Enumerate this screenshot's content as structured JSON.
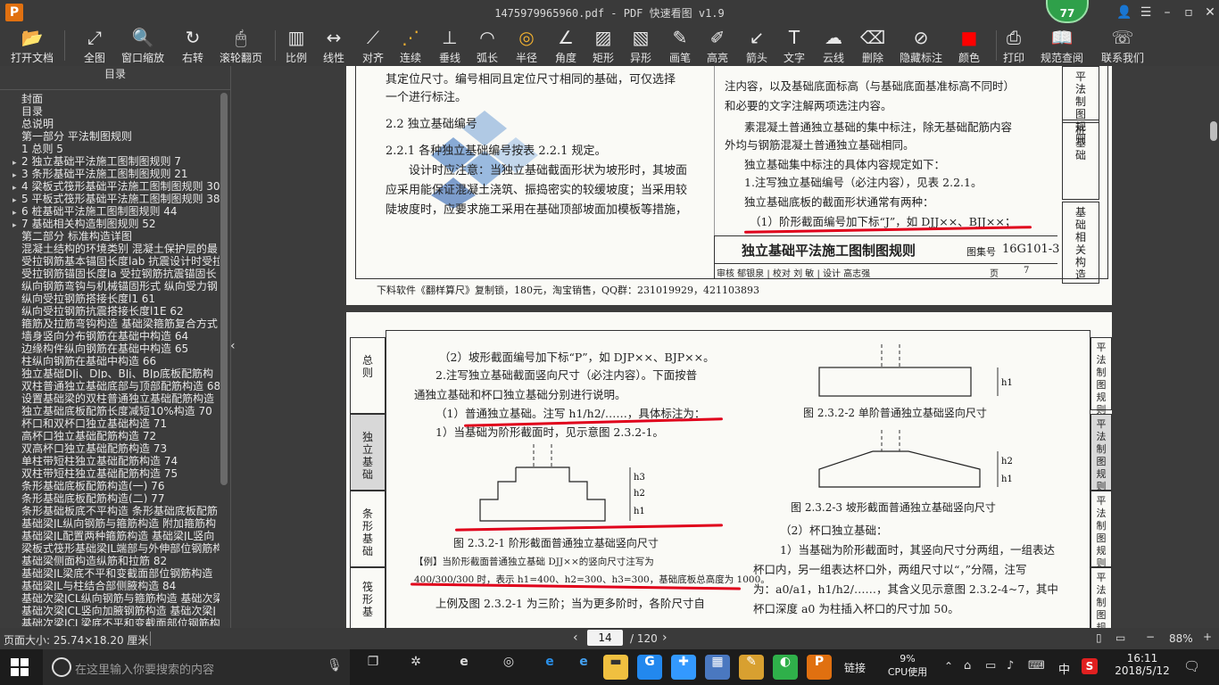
{
  "window": {
    "title": "1475979965960.pdf - PDF 快速看图 v1.9",
    "badge": "77"
  },
  "toolbar": [
    {
      "name": "open",
      "label": "打开文档",
      "icon": "📂"
    },
    {
      "name": "fit-all",
      "label": "全图",
      "icon": "⤢"
    },
    {
      "name": "window-zoom",
      "label": "窗口缩放",
      "icon": "🔍"
    },
    {
      "name": "rotate",
      "label": "右转",
      "icon": "↻"
    },
    {
      "name": "scroll-page",
      "label": "滚轮翻页",
      "icon": "🖱"
    },
    {
      "name": "scale",
      "label": "比例",
      "icon": "▥"
    },
    {
      "name": "linear",
      "label": "线性",
      "icon": "↔"
    },
    {
      "name": "align",
      "label": "对齐",
      "icon": "⟋"
    },
    {
      "name": "continuous",
      "label": "连续",
      "icon": "⋰"
    },
    {
      "name": "perpendicular",
      "label": "垂线",
      "icon": "⊥"
    },
    {
      "name": "arc",
      "label": "弧长",
      "icon": "◠"
    },
    {
      "name": "radius",
      "label": "半径",
      "icon": "◎"
    },
    {
      "name": "angle",
      "label": "角度",
      "icon": "∠"
    },
    {
      "name": "rect",
      "label": "矩形",
      "icon": "▨"
    },
    {
      "name": "shape",
      "label": "异形",
      "icon": "▧"
    },
    {
      "name": "pen",
      "label": "画笔",
      "icon": "✎"
    },
    {
      "name": "highlight",
      "label": "高亮",
      "icon": "✐"
    },
    {
      "name": "arrow",
      "label": "箭头",
      "icon": "↙"
    },
    {
      "name": "text",
      "label": "文字",
      "icon": "T"
    },
    {
      "name": "cloud",
      "label": "云线",
      "icon": "☁"
    },
    {
      "name": "delete",
      "label": "删除",
      "icon": "⌫"
    },
    {
      "name": "hide",
      "label": "隐藏标注",
      "icon": "⊘"
    },
    {
      "name": "color",
      "label": "颜色",
      "icon": "■"
    },
    {
      "name": "print",
      "label": "打印",
      "icon": "⎙"
    },
    {
      "name": "spec",
      "label": "规范查阅",
      "icon": "📖"
    },
    {
      "name": "contact",
      "label": "联系我们",
      "icon": "☏"
    }
  ],
  "sidebar": {
    "title": "目录",
    "items": [
      {
        "text": "封面",
        "arrow": ""
      },
      {
        "text": "目录",
        "arrow": ""
      },
      {
        "text": "总说明",
        "arrow": ""
      },
      {
        "text": "第一部分  平法制图规则",
        "arrow": ""
      },
      {
        "text": "1 总则 5",
        "arrow": ""
      },
      {
        "text": "2 独立基础平法施工图制图规则 7",
        "arrow": "▸"
      },
      {
        "text": "3 条形基础平法施工图制图规则 21",
        "arrow": "▸"
      },
      {
        "text": "4 梁板式筏形基础平法施工图制图规则 30",
        "arrow": "▸"
      },
      {
        "text": "5 平板式筏形基础平法施工图制图规则 38",
        "arrow": "▸"
      },
      {
        "text": "6 桩基础平法施工图制图规则 44",
        "arrow": "▸"
      },
      {
        "text": "7 基础相关构造制图规则 52",
        "arrow": "▸"
      },
      {
        "text": "第二部分  标准构造详图",
        "arrow": ""
      },
      {
        "text": "混凝土结构的环境类别 混凝土保护层的最",
        "arrow": ""
      },
      {
        "text": "受拉钢筋基本锚固长度lab 抗震设计时受拉",
        "arrow": ""
      },
      {
        "text": "受拉钢筋锚固长度la 受拉钢筋抗震锚固长",
        "arrow": ""
      },
      {
        "text": "纵向钢筋弯钩与机械锚固形式 纵向受力钢",
        "arrow": ""
      },
      {
        "text": "纵向受拉钢筋搭接长度l1 61",
        "arrow": ""
      },
      {
        "text": "纵向受拉钢筋抗震搭接长度l1E 62",
        "arrow": ""
      },
      {
        "text": "箍筋及拉筋弯钩构造 基础梁箍筋复合方式",
        "arrow": ""
      },
      {
        "text": "墙身竖向分布钢筋在基础中构造 64",
        "arrow": ""
      },
      {
        "text": "边缘构件纵向钢筋在基础中构造 65",
        "arrow": ""
      },
      {
        "text": "柱纵向钢筋在基础中构造 66",
        "arrow": ""
      },
      {
        "text": "独立基础DJj、DJp、BJj、BJp底板配筋构",
        "arrow": ""
      },
      {
        "text": "双柱普通独立基础底部与顶部配筋构造 68",
        "arrow": ""
      },
      {
        "text": "设置基础梁的双柱普通独立基础配筋构造",
        "arrow": ""
      },
      {
        "text": "独立基础底板配筋长度减短10%构造 70",
        "arrow": ""
      },
      {
        "text": "杯口和双杯口独立基础构造 71",
        "arrow": ""
      },
      {
        "text": "高杯口独立基础配筋构造 72",
        "arrow": ""
      },
      {
        "text": "双高杯口独立基础配筋构造 73",
        "arrow": ""
      },
      {
        "text": "单柱带短柱独立基础配筋构造 74",
        "arrow": ""
      },
      {
        "text": "双柱带短柱独立基础配筋构造 75",
        "arrow": ""
      },
      {
        "text": "条形基础底板配筋构造(一) 76",
        "arrow": ""
      },
      {
        "text": "条形基础底板配筋构造(二) 77",
        "arrow": ""
      },
      {
        "text": "条形基础板底不平构造 条形基础底板配筋",
        "arrow": ""
      },
      {
        "text": "基础梁JL纵向钢筋与箍筋构造 附加箍筋构",
        "arrow": ""
      },
      {
        "text": "基础梁JL配置两种箍筋构造 基础梁JL竖向",
        "arrow": ""
      },
      {
        "text": "梁板式筏形基础梁JL端部与外伸部位钢筋构",
        "arrow": ""
      },
      {
        "text": "基础梁侧面构造纵筋和拉筋 82",
        "arrow": ""
      },
      {
        "text": "基础梁JL梁底不平和变截面部位钢筋构造",
        "arrow": ""
      },
      {
        "text": "基础梁JL与柱结合部侧腋构造 84",
        "arrow": ""
      },
      {
        "text": "基础次梁JCL纵向钢筋与箍筋构造 基础次梁",
        "arrow": ""
      },
      {
        "text": "基础次梁JCL竖向加腋钢筋构造 基础次梁J",
        "arrow": ""
      },
      {
        "text": "基础次梁JCL梁底不平和变截面部位钢筋构",
        "arrow": ""
      }
    ]
  },
  "page1": {
    "top_text1": "其定位尺寸。编号相同且定位尺寸相同的基础，可仅选择",
    "top_text2": "一个进行标注。",
    "sec_title": "2.2  独立基础编号",
    "sec_221": "2.2.1  各种独立基础编号按表 2.2.1 规定。",
    "sec_para1": "设计时应注意：当独立基础截面形状为坡形时，其坡面",
    "sec_para2": "应采用能保证混凝土浇筑、振捣密实的较缓坡度；当采用较",
    "sec_para3": "陡坡度时，应要求施工采用在基础顶部坡面加模板等措施，",
    "r_text1": "注内容，以及基础底面标高（与基础底面基准标高不同时）",
    "r_text2": "和必要的文字注解两项选注内容。",
    "r_text3": "素混凝土普通独立基础的集中标注，除无基础配筋内容",
    "r_text4": "外均与钢筋混凝土普通独立基础相同。",
    "r_text5": "独立基础集中标注的具体内容规定如下：",
    "r_text6": "1.注写独立基础编号（必注内容），见表 2.2.1。",
    "r_text7": "独立基础底板的截面形状通常有两种：",
    "r_text8": "（1）阶形截面编号加下标“J”，如 DJJ××、BJJ××；",
    "title_block": "独立基础平法施工图制图规则",
    "atlas_label": "图集号",
    "atlas_no": "16G101-3",
    "review_row": "审核 郁银泉 | 校对 刘  敏 | 设计 高志强",
    "page_label": "页",
    "page_no": "7",
    "tab1": "平法制图规则",
    "tab2": "桩基础",
    "tab3": "基础相关构造",
    "footer": "下料软件《翻样算尺》复制锁，180元，淘宝销售，QQ群：231019929，421103893"
  },
  "page2": {
    "l1": "（2）坡形截面编号加下标“P”，如 DJP××、BJP××。",
    "l2": "2.注写独立基础截面竖向尺寸（必注内容）。下面按普",
    "l3": "通独立基础和杯口独立基础分别进行说明。",
    "l4": "（1）普通独立基础。注写 h1/h2/……，具体标注为：",
    "l5": "1）当基础为阶形截面时，见示意图 2.3.2-1。",
    "fig1": "图 2.3.2-1  阶形截面普通独立基础竖向尺寸",
    "ex1": "【例】当阶形截面普通独立基础 DJJ××的竖向尺寸注写为",
    "ex2": "400/300/300 时，表示 h1=400、h2=300、h3=300，基础底板总高度为 1000。",
    "ex3": "上例及图 2.3.2-1 为三阶；当为更多阶时，各阶尺寸自",
    "fig2": "图 2.3.2-2  单阶普通独立基础竖向尺寸",
    "fig3": "图 2.3.2-3  坡形截面普通独立基础竖向尺寸",
    "r1": "（2）杯口独立基础：",
    "r2": "1）当基础为阶形截面时，其竖向尺寸分两组，一组表达",
    "r3": "杯口内，另一组表达杯口外，两组尺寸以“，”分隔，注写",
    "r4": "为：a0/a1，h1/h2/……，其含义见示意图 2.3.2-4~7，其中",
    "r5": "杯口深度 a0 为柱插入杯口的尺寸加 50。",
    "ltab1": "总则",
    "ltab1b": "平法制图规则",
    "ltab2": "独立基础",
    "ltab2b": "平法制图规则",
    "ltab3": "条形基础",
    "ltab3b": "平法制图规则",
    "ltab4": "筏形基",
    "ltab4b": "平法制图",
    "rtab1": "平法制图规则",
    "rtab2": "平法制图规则",
    "rtab3": "平法制图规则",
    "rtab4": "平法制图规则"
  },
  "status": {
    "page_size": "页面大小: 25.74×18.20 厘米",
    "current_page": "14",
    "total_pages": "/ 120",
    "zoom": "88%"
  },
  "taskbar": {
    "search_placeholder": "在这里输入你要搜索的内容",
    "link": "链接",
    "cpu": "9%",
    "cpu_label": "CPU使用",
    "ime": "中",
    "time": "16:11",
    "date": "2018/5/12"
  }
}
